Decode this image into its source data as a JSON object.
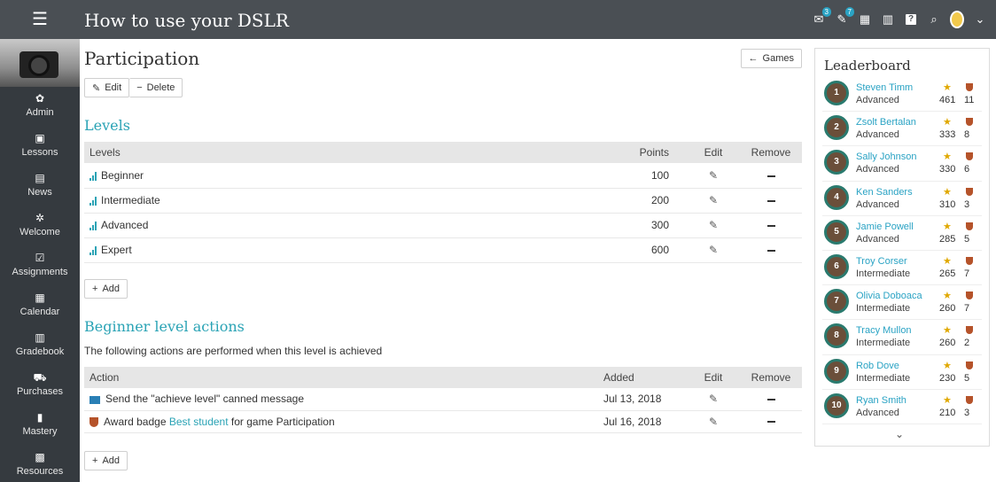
{
  "topbar": {
    "menu_icon": "hamburger-icon",
    "title": "How to use your DSLR",
    "icons": [
      {
        "name": "messages-icon",
        "badge": "3"
      },
      {
        "name": "notifications-icon",
        "badge": "7"
      },
      {
        "name": "calendar-icon"
      },
      {
        "name": "trash-icon"
      },
      {
        "name": "help-icon",
        "glyph": "?"
      },
      {
        "name": "search-icon"
      },
      {
        "name": "user-avatar-icon"
      },
      {
        "name": "chevron-down-icon"
      }
    ]
  },
  "sidebar": {
    "items": [
      {
        "label": "Admin",
        "icon": "gear-icon",
        "glyph": "✿"
      },
      {
        "label": "Lessons",
        "icon": "lessons-icon",
        "glyph": "▣"
      },
      {
        "label": "News",
        "icon": "news-icon",
        "glyph": "▤"
      },
      {
        "label": "Welcome",
        "icon": "welcome-icon",
        "glyph": "✲"
      },
      {
        "label": "Assignments",
        "icon": "assignments-icon",
        "glyph": "☑"
      },
      {
        "label": "Calendar",
        "icon": "calendar-icon",
        "glyph": "▦"
      },
      {
        "label": "Gradebook",
        "icon": "gradebook-icon",
        "glyph": "▥"
      },
      {
        "label": "Purchases",
        "icon": "cart-icon",
        "glyph": "⛟"
      },
      {
        "label": "Mastery",
        "icon": "mastery-icon",
        "glyph": "▮"
      },
      {
        "label": "Resources",
        "icon": "resources-icon",
        "glyph": "▩"
      }
    ]
  },
  "page": {
    "title": "Participation",
    "edit_label": "Edit",
    "delete_label": "Delete",
    "games_label": "Games"
  },
  "levels": {
    "title": "Levels",
    "columns": [
      "Levels",
      "Points",
      "Edit",
      "Remove"
    ],
    "rows": [
      {
        "name": "Beginner",
        "points": "100"
      },
      {
        "name": "Intermediate",
        "points": "200"
      },
      {
        "name": "Advanced",
        "points": "300"
      },
      {
        "name": "Expert",
        "points": "600"
      }
    ],
    "add_label": "Add"
  },
  "actions": {
    "title": "Beginner level actions",
    "description": "The following actions are performed when this level is achieved",
    "columns": [
      "Action",
      "Added",
      "Edit",
      "Remove"
    ],
    "rows": [
      {
        "icon": "mail-icon",
        "text": "Send the \"achieve level\" canned message",
        "added": "Jul 13, 2018"
      },
      {
        "icon": "badge-icon",
        "prefix": "Award badge ",
        "link": "Best student",
        "suffix": " for game Participation",
        "added": "Jul 16, 2018"
      }
    ],
    "add_label": "Add"
  },
  "leaderboard": {
    "title": "Leaderboard",
    "rows": [
      {
        "rank": "1",
        "name": "Steven Timm",
        "level": "Advanced",
        "points": "461",
        "badges": "11"
      },
      {
        "rank": "2",
        "name": "Zsolt Bertalan",
        "level": "Advanced",
        "points": "333",
        "badges": "8"
      },
      {
        "rank": "3",
        "name": "Sally Johnson",
        "level": "Advanced",
        "points": "330",
        "badges": "6"
      },
      {
        "rank": "4",
        "name": "Ken Sanders",
        "level": "Advanced",
        "points": "310",
        "badges": "3"
      },
      {
        "rank": "5",
        "name": "Jamie Powell",
        "level": "Advanced",
        "points": "285",
        "badges": "5"
      },
      {
        "rank": "6",
        "name": "Troy Corser",
        "level": "Intermediate",
        "points": "265",
        "badges": "7"
      },
      {
        "rank": "7",
        "name": "Olivia Doboaca",
        "level": "Intermediate",
        "points": "260",
        "badges": "7"
      },
      {
        "rank": "8",
        "name": "Tracy Mullon",
        "level": "Intermediate",
        "points": "260",
        "badges": "2"
      },
      {
        "rank": "9",
        "name": "Rob Dove",
        "level": "Intermediate",
        "points": "230",
        "badges": "5"
      },
      {
        "rank": "10",
        "name": "Ryan Smith",
        "level": "Advanced",
        "points": "210",
        "badges": "3"
      }
    ],
    "more_icon": "chevron-down-icon"
  },
  "colors": {
    "topbar": "#4a4f54",
    "sidebar": "#353a3f",
    "accent": "#2aa3b5",
    "star": "#e0a800",
    "badge": "#b5532a"
  }
}
